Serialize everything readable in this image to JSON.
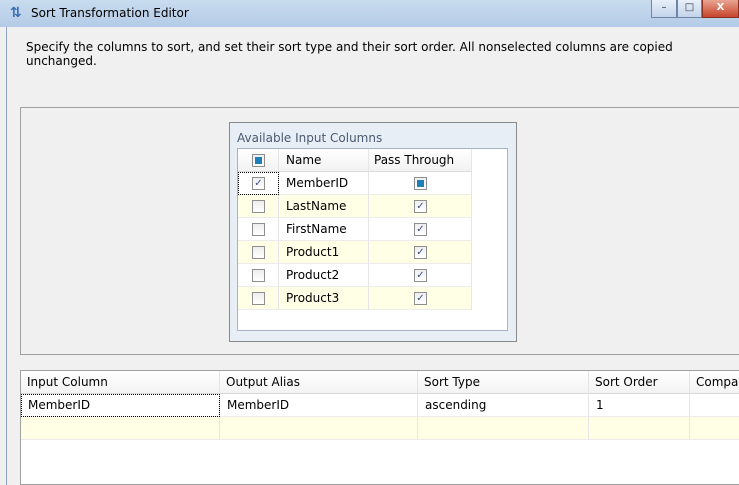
{
  "window": {
    "title": "Sort Transformation Editor",
    "icon": "sort-icon"
  },
  "description": "Specify the columns to sort, and set their sort type and their sort order. All nonselected columns are copied unchanged.",
  "available": {
    "title": "Available Input Columns",
    "headers": {
      "name": "Name",
      "pass_through": "Pass Through"
    },
    "header_check_state": "indeterminate",
    "rows": [
      {
        "name": "MemberID",
        "selected": true,
        "pass_through": "indeterminate"
      },
      {
        "name": "LastName",
        "selected": false,
        "pass_through": "checked"
      },
      {
        "name": "FirstName",
        "selected": false,
        "pass_through": "checked"
      },
      {
        "name": "Product1",
        "selected": false,
        "pass_through": "checked"
      },
      {
        "name": "Product2",
        "selected": false,
        "pass_through": "checked"
      },
      {
        "name": "Product3",
        "selected": false,
        "pass_through": "checked"
      }
    ]
  },
  "sort_grid": {
    "headers": [
      "Input Column",
      "Output Alias",
      "Sort Type",
      "Sort Order",
      "Compa"
    ],
    "rows": [
      [
        "MemberID",
        "MemberID",
        "ascending",
        "1",
        ""
      ]
    ]
  },
  "colors": {
    "row_alt": "#ffffe6",
    "indeterminate": "#1f7fb8"
  }
}
